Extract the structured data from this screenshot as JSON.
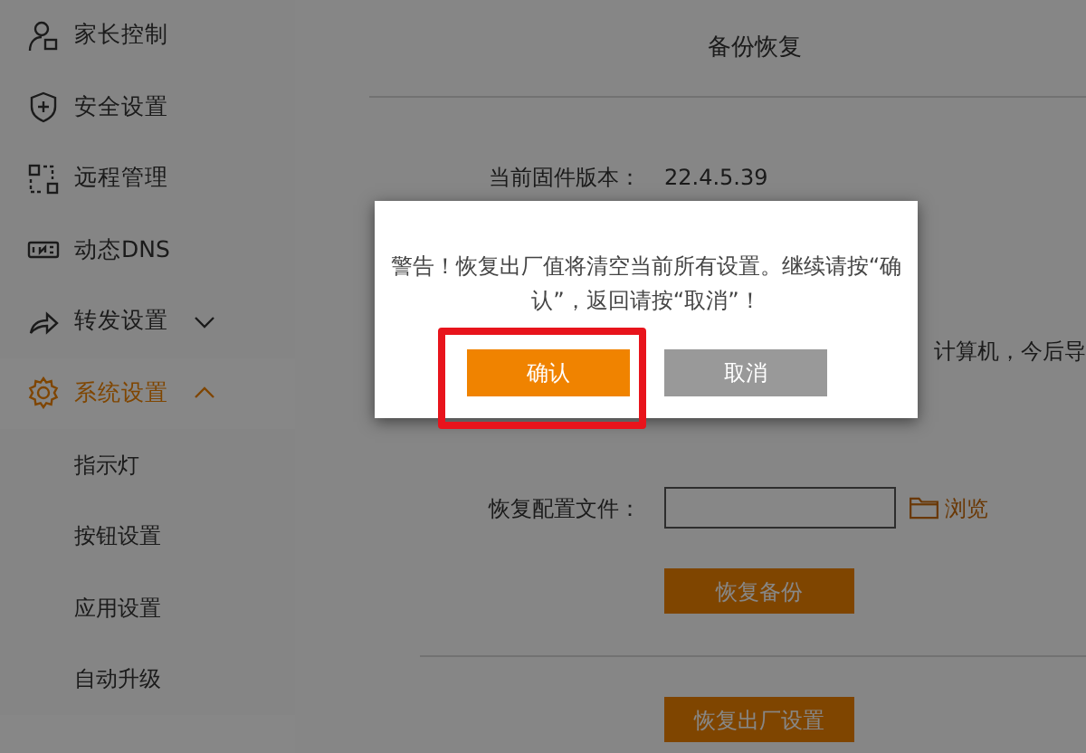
{
  "sidebar": {
    "items": [
      {
        "label": "家长控制",
        "selected": false
      },
      {
        "label": "安全设置",
        "selected": false
      },
      {
        "label": "远程管理",
        "selected": false
      },
      {
        "label": "动态DNS",
        "selected": false
      },
      {
        "label": "转发设置",
        "selected": false,
        "expanded": false
      },
      {
        "label": "系统设置",
        "selected": true,
        "expanded": true,
        "children": [
          {
            "label": "指示灯",
            "selected": false
          },
          {
            "label": "按钮设置",
            "selected": false
          },
          {
            "label": "应用设置",
            "selected": false
          },
          {
            "label": "自动升级",
            "selected": false
          }
        ]
      }
    ]
  },
  "page": {
    "title": "备份恢复",
    "firmware": {
      "label": "当前固件版本：",
      "value": "22.4.5.39"
    },
    "partial_text": "计算机，今后导",
    "restore": {
      "label": "恢复配置文件：",
      "browse": "浏览",
      "button": "恢复备份"
    },
    "factory_button": "恢复出厂设置"
  },
  "dialog": {
    "message": "警告！恢复出厂值将清空当前所有设置。继续请按“确认”，返回请按“取消”！",
    "buttons": [
      {
        "label": "确认",
        "kind": "primary",
        "highlighted": true
      },
      {
        "label": "取消",
        "kind": "secondary",
        "highlighted": false
      }
    ]
  }
}
